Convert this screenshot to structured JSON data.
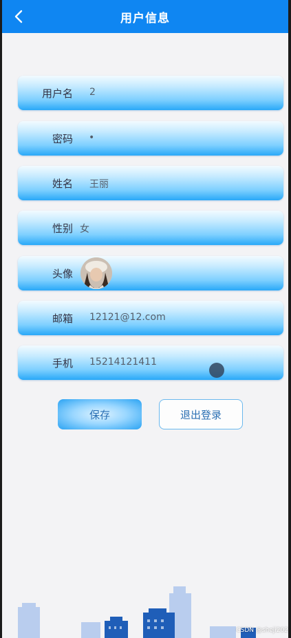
{
  "header": {
    "title": "用户信息"
  },
  "fields": [
    {
      "label": "用户名",
      "value": "2"
    },
    {
      "label": "密码",
      "value": "•"
    },
    {
      "label": "姓名",
      "value": "王丽"
    },
    {
      "label": "性别",
      "value": "女"
    },
    {
      "label": "头像",
      "value": ""
    },
    {
      "label": "邮箱",
      "value": "12121@12.com"
    },
    {
      "label": "手机",
      "value": "15214121411"
    }
  ],
  "actions": {
    "save": "保存",
    "logout": "退出登录"
  },
  "watermark": "CSDN @sheji202",
  "icons": {
    "back": "chevron-left-icon"
  },
  "colors": {
    "header": "#0f86f2",
    "accent": "#29a8f8"
  }
}
